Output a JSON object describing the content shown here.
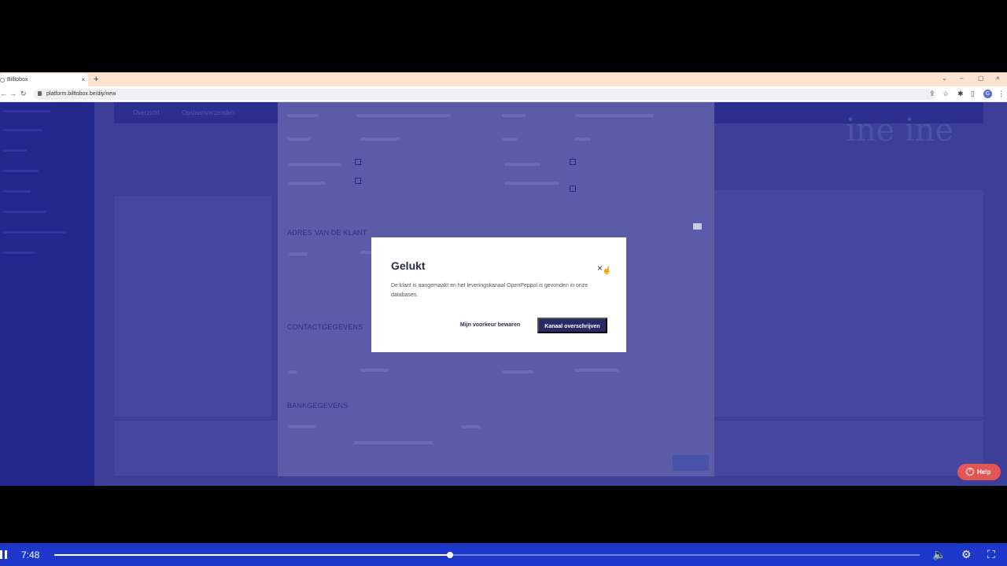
{
  "browser": {
    "tab_title": "Billtobox",
    "tab_close": "×",
    "new_tab": "+",
    "url": "platform.billtobox.be/diy/new",
    "window_controls": [
      "⌄",
      "–",
      "▢",
      "×"
    ],
    "profile_initial": "G"
  },
  "page": {
    "nav_items": [
      "Overzicht",
      "Opslaanverzenden"
    ],
    "logo_text": "ine ine",
    "section_address": "ADRES VAN DE KLANT",
    "section_contact": "CONTACTGEGEVENS",
    "section_bank": "BANKGEGEVENS"
  },
  "modal": {
    "title": "Gelukt",
    "close": "×",
    "message": "De klant is aangemaakt en het leveringskanaal OpenPeppol is gevonden in onze databases.",
    "secondary_label": "Mijn voorkeur bewaren",
    "primary_label": "Kanaal overschrijven"
  },
  "help": {
    "label": "Help"
  },
  "player": {
    "time": "7:48",
    "progress": 0.457
  },
  "colors": {
    "modal_primary": "#272a64",
    "player_bar": "#1c37c9",
    "help": "#e25656"
  }
}
